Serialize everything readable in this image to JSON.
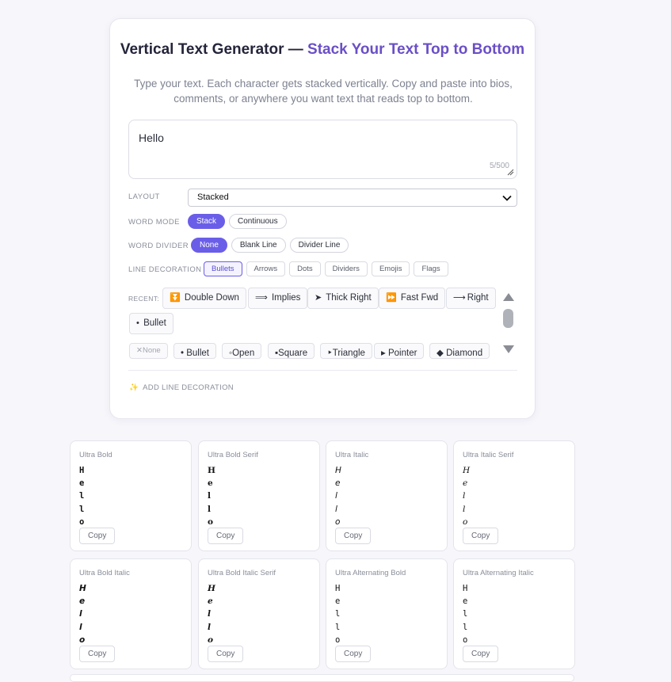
{
  "header": {
    "title_main": "Vertical Text Generator — ",
    "title_accent": "Stack Your Text Top to Bottom",
    "subtitle": "Type your text. Each character gets stacked vertically. Copy and paste into bios, comments, or anywhere you want text that reads top to bottom.",
    "accent_color": "#6a4fc7"
  },
  "input": {
    "value": "Hello",
    "counter": "5/500"
  },
  "layout": {
    "label": "LAYOUT",
    "selected": "Stacked"
  },
  "word_mode": {
    "label": "WORD MODE",
    "options": [
      "Stack",
      "Continuous"
    ],
    "active": "Stack"
  },
  "word_divider": {
    "label": "WORD DIVIDER",
    "options": [
      "None",
      "Blank Line",
      "Divider Line"
    ],
    "active": "None"
  },
  "line_decoration": {
    "label": "LINE DECORATION",
    "categories": [
      "Bullets",
      "Arrows",
      "Dots",
      "Dividers",
      "Emojis",
      "Flags"
    ],
    "active": "Bullets"
  },
  "recent": {
    "label": "RECENT:",
    "items": [
      {
        "icon": "⏬",
        "label": "Double Down"
      },
      {
        "icon": "⟹",
        "label": "Implies"
      },
      {
        "icon": "➤",
        "label": "Thick Right"
      },
      {
        "icon": "⏩",
        "label": "Fast Fwd"
      },
      {
        "icon": "⟶",
        "label": "Right"
      },
      {
        "icon": "•",
        "label": "Bullet"
      }
    ]
  },
  "decorations": {
    "items": [
      {
        "icon": "✕",
        "label": "None"
      },
      {
        "icon": "•",
        "label": "Bullet"
      },
      {
        "icon": "◦",
        "label": "Open"
      },
      {
        "icon": "▪",
        "label": "Square"
      },
      {
        "icon": "‣",
        "label": "Triangle"
      },
      {
        "icon": "▸",
        "label": "Pointer"
      },
      {
        "icon": "◆",
        "label": "Diamond"
      }
    ]
  },
  "add_decoration": "ADD LINE DECORATION",
  "copy_label": "Copy",
  "results": [
    {
      "name": "Ultra Bold",
      "lines": [
        "H",
        "e",
        "l",
        "l",
        "o"
      ]
    },
    {
      "name": "Ultra Bold Serif",
      "lines": [
        "H",
        "e",
        "l",
        "l",
        "o"
      ]
    },
    {
      "name": "Ultra Italic",
      "lines": [
        "H",
        "e",
        "l",
        "l",
        "o"
      ]
    },
    {
      "name": "Ultra Italic Serif",
      "lines": [
        "H",
        "e",
        "l",
        "l",
        "o"
      ]
    },
    {
      "name": "Ultra Bold Italic",
      "lines": [
        "H",
        "e",
        "l",
        "l",
        "o"
      ]
    },
    {
      "name": "Ultra Bold Italic Serif",
      "lines": [
        "H",
        "e",
        "l",
        "l",
        "o"
      ]
    },
    {
      "name": "Ultra Alternating Bold",
      "lines": [
        "H",
        "e",
        "l",
        "l",
        "o"
      ]
    },
    {
      "name": "Ultra Alternating Italic",
      "lines": [
        "H",
        "e",
        "l",
        "l",
        "o"
      ]
    }
  ]
}
